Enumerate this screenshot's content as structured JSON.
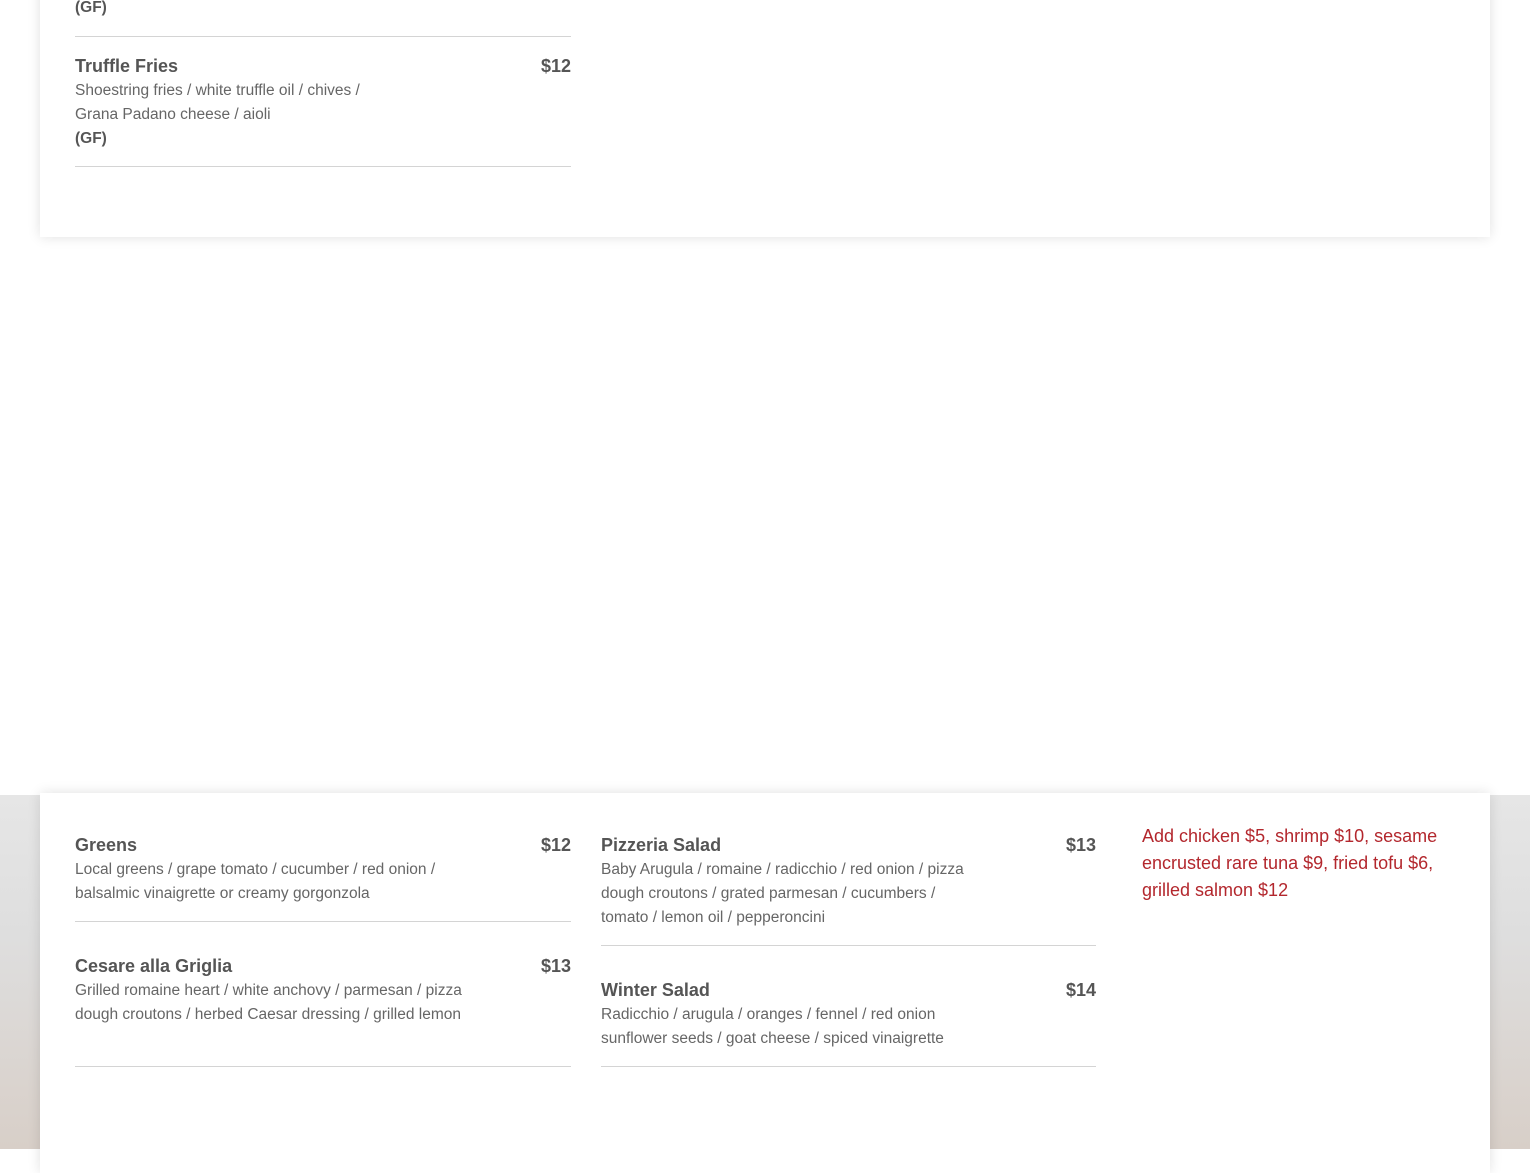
{
  "top_section": {
    "prev_item_tag": "(GF)",
    "items": [
      {
        "name": "Truffle Fries",
        "price": "$12",
        "desc": "Shoestring fries / white truffle oil  / chives / Grana Padano cheese / aioli",
        "tag": "(GF)"
      }
    ]
  },
  "salads": {
    "items": [
      {
        "name": "Greens",
        "price": "$12",
        "desc": "Local greens / grape tomato / cucumber / red onion / balsalmic vinaigrette or creamy gorgonzola"
      },
      {
        "name": "Cesare alla Griglia",
        "price": "$13",
        "desc": "Grilled romaine heart / white anchovy / parmesan / pizza dough croutons / herbed Caesar dressing / grilled lemon"
      },
      {
        "name": "Pizzeria Salad",
        "price": "$13",
        "desc": "Baby Arugula / romaine / radicchio / red onion / pizza dough croutons / grated parmesan / cucumbers / tomato / lemon oil / pepperoncini"
      },
      {
        "name": "Winter Salad",
        "price": "$14",
        "desc": "Radicchio /  arugula  / oranges / fennel / red onion  sunflower seeds  / goat cheese / spiced vinaigrette"
      }
    ],
    "addon_note": "Add chicken $5, shrimp $10, sesame encrusted rare tuna $9, fried tofu $6, grilled salmon $12"
  },
  "colors": {
    "accent_red": "#b3272d",
    "text_dark": "#555555",
    "text_body": "#666666"
  }
}
